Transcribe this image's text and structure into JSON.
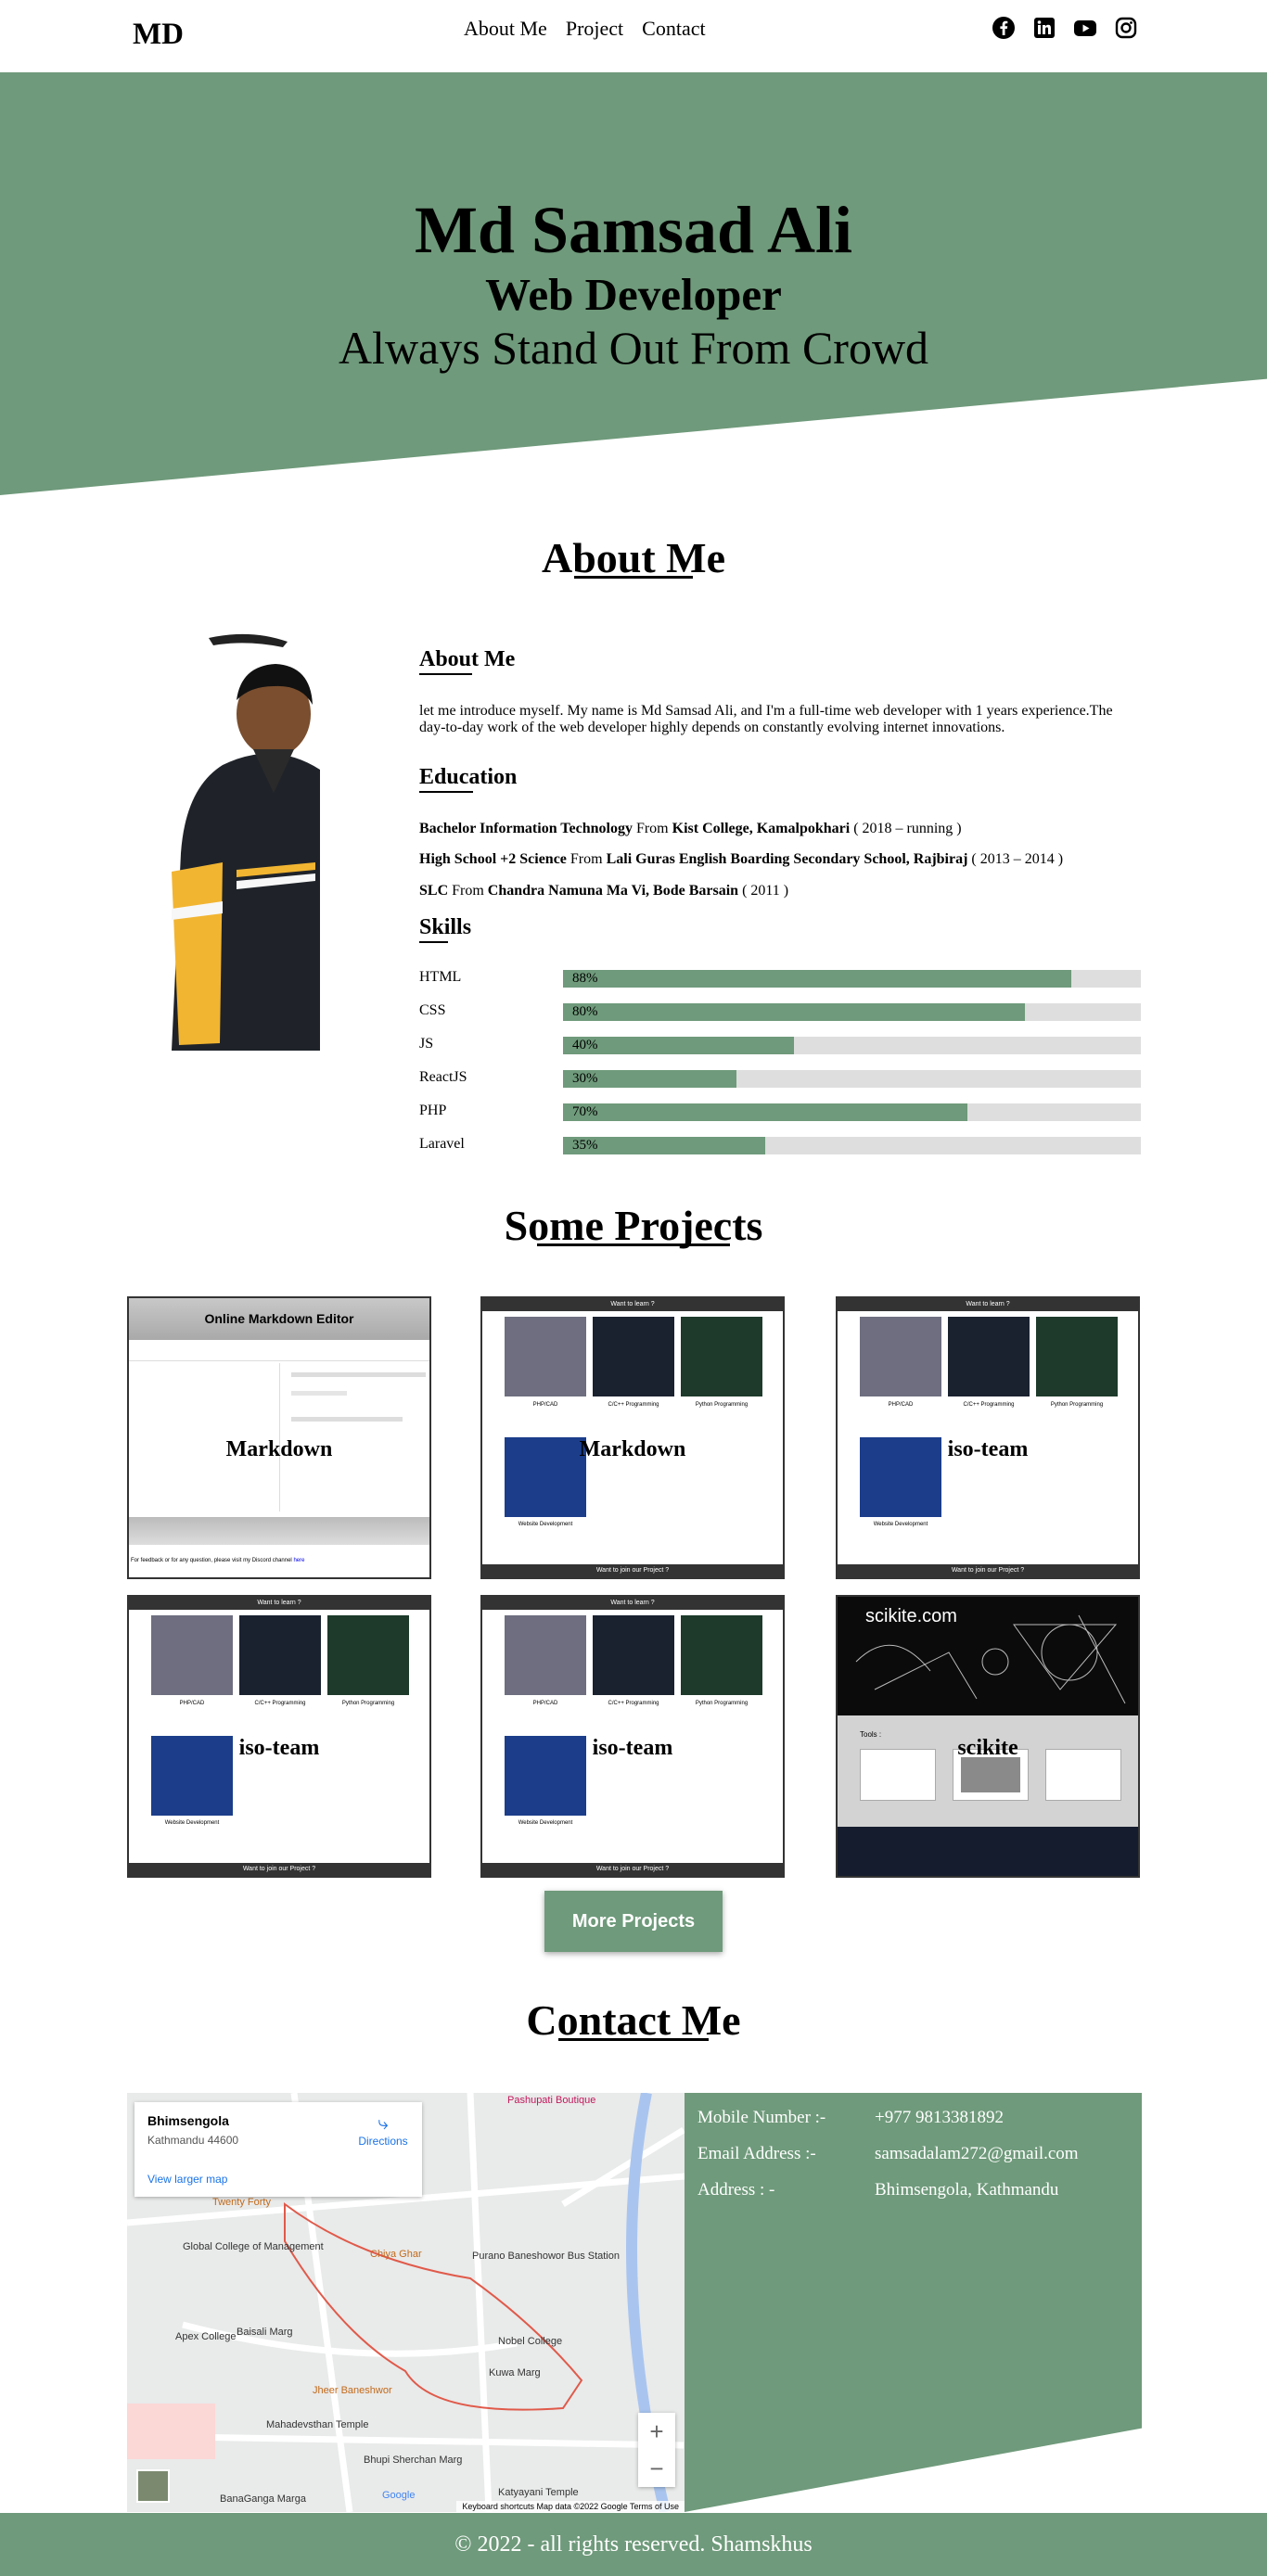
{
  "nav": {
    "logo": "MD",
    "links": [
      "About Me",
      "Project",
      "Contact"
    ],
    "social": [
      "facebook-icon",
      "linkedin-icon",
      "youtube-icon",
      "instagram-icon"
    ]
  },
  "hero": {
    "name": "Md Samsad Ali",
    "role": "Web Developer",
    "tagline": "Always Stand Out From Crowd"
  },
  "about": {
    "title": "About Me",
    "sub_about": "About Me",
    "intro": "let me introduce myself. My name is Md Samsad Ali, and I'm a full-time web developer with 1 years experience.The day-to-day work of the web developer highly depends on constantly evolving internet innovations.",
    "sub_education": "Education",
    "education": [
      {
        "degree": "Bachelor Information Technology",
        "from": " From ",
        "school": "Kist College, Kamalpokhari",
        "years": " ( 2018 – running )"
      },
      {
        "degree": "High School +2 Science",
        "from": " From ",
        "school": "Lali Guras English Boarding Secondary School, Rajbiraj",
        "years": " ( 2013 – 2014 )"
      },
      {
        "degree": "SLC",
        "from": " From ",
        "school": "Chandra Namuna Ma Vi, Bode Barsain",
        "years": " ( 2011 )"
      }
    ],
    "sub_skills": "Skills",
    "skills": [
      {
        "name": "HTML",
        "label": "88%",
        "level": 0.88
      },
      {
        "name": "CSS",
        "label": "80%",
        "level": 0.8
      },
      {
        "name": "JS",
        "label": "40%",
        "level": 0.4
      },
      {
        "name": "ReactJS",
        "label": "30%",
        "level": 0.3
      },
      {
        "name": "PHP",
        "label": "70%",
        "level": 0.7
      },
      {
        "name": "Laravel",
        "label": "35%",
        "level": 0.35
      }
    ]
  },
  "projects": {
    "title": "Some Projects",
    "items": [
      "Markdown",
      "Markdown",
      "iso-team",
      "iso-team",
      "iso-team",
      "scikite"
    ],
    "md_header": "Online Markdown Editor",
    "md_footer": "For feedback or for any question, please visit my Discord channel",
    "md_link": "here",
    "iso_top": "Want to learn ?",
    "iso_bottom": "Want to join our Project ?",
    "iso_cards": [
      "PHP/CAD",
      "C/C++ Programming",
      "Python Programming",
      "Website Development"
    ],
    "scikite_brand": "scikite.com",
    "scikite_tools": "Tools :",
    "more": "More Projects"
  },
  "contact": {
    "title": "Contact Me",
    "map": {
      "place": "Bhimsengola",
      "area": "Kathmandu 44600",
      "directions": "Directions",
      "larger": "View larger map",
      "footer": "Keyboard shortcuts   Map data ©2022 Google   Terms of Use",
      "labels": [
        "Pashupati Boutique",
        "Twenty Forty",
        "Global College of Management",
        "Chiya Ghar",
        "Purano Baneshowor Bus Station",
        "Apex College",
        "Nobel College",
        "Jheer Baneshwor",
        "Mahadevsthan Temple",
        "Bhupi Sherchan Marg",
        "Katyayani Temple",
        "BanaGanga Marga",
        "Baisali Marg",
        "Kuwa Marg",
        "Google"
      ]
    },
    "rows": [
      {
        "label": "Mobile Number :-",
        "value": "+977 9813381892"
      },
      {
        "label": "Email Address :-",
        "value": "samsadalam272@gmail.com"
      },
      {
        "label": "Address : -",
        "value": "Bhimsengola, Kathmandu"
      }
    ]
  },
  "footer": {
    "text": "© 2022 - all rights reserved. Shamskhus"
  },
  "colors": {
    "accent": "#6f9a7b",
    "dark": "#333333"
  }
}
